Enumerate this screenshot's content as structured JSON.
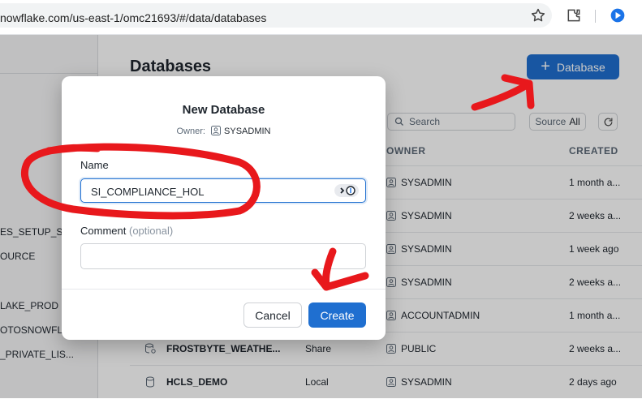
{
  "browser": {
    "url": "nowflake.com/us-east-1/omc21693/#/data/databases"
  },
  "sidebar": {
    "items": [
      {
        "label": "ES_SETUP_S"
      },
      {
        "label": "OURCE"
      },
      {
        "label": "LAKE_PROD"
      },
      {
        "label": "OTOSNOWFL"
      },
      {
        "label": "_PRIVATE_LIS..."
      }
    ]
  },
  "page": {
    "title": "Databases",
    "add_button_label": "Database",
    "search_placeholder": "Search",
    "source_label": "Source",
    "source_value": "All"
  },
  "table": {
    "columns": {
      "owner": "OWNER",
      "created": "CREATED"
    },
    "rows": [
      {
        "owner": "SYSADMIN",
        "created": "1 month a..."
      },
      {
        "owner": "SYSADMIN",
        "created": "2 weeks a..."
      },
      {
        "owner": "SYSADMIN",
        "created": "1 week ago"
      },
      {
        "owner": "SYSADMIN",
        "created": "2 weeks a..."
      },
      {
        "owner": "ACCOUNTADMIN",
        "created": "1 month a..."
      },
      {
        "name": "FROSTBYTE_WEATHE...",
        "source": "Share",
        "owner": "PUBLIC",
        "created": "2 weeks a..."
      },
      {
        "name": "HCLS_DEMO",
        "source": "Local",
        "owner": "SYSADMIN",
        "created": "2 days ago"
      }
    ]
  },
  "modal": {
    "title": "New Database",
    "owner_label": "Owner:",
    "owner_value": "SYSADMIN",
    "name_label": "Name",
    "name_value": "SI_COMPLIANCE_HOL",
    "comment_label": "Comment",
    "comment_optional": "(optional)",
    "cancel_label": "Cancel",
    "create_label": "Create"
  },
  "colors": {
    "primary": "#1f6fd0",
    "annotation_red": "#e8181c"
  }
}
